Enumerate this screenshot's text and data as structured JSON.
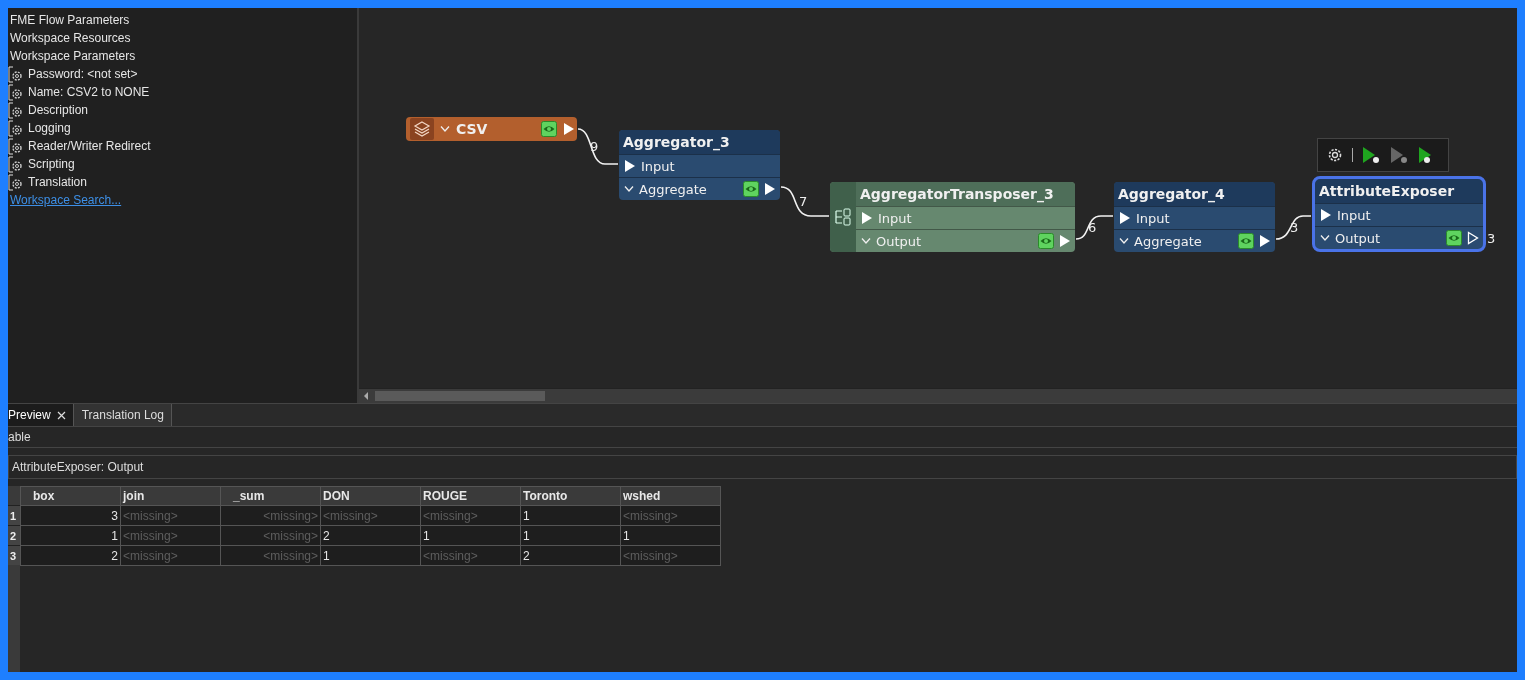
{
  "navigator": {
    "items": [
      {
        "kind": "heading",
        "label": "FME Flow Parameters"
      },
      {
        "kind": "heading",
        "label": "Workspace Resources"
      },
      {
        "kind": "heading",
        "label": "Workspace Parameters"
      },
      {
        "kind": "parameter",
        "label": "Password: <not set>"
      },
      {
        "kind": "parameter",
        "label": "Name: CSV2 to NONE"
      },
      {
        "kind": "parameter",
        "label": "Description"
      },
      {
        "kind": "parameter",
        "label": "Logging"
      },
      {
        "kind": "parameter",
        "label": "Reader/Writer Redirect"
      },
      {
        "kind": "parameter",
        "label": "Scripting"
      },
      {
        "kind": "parameter",
        "label": "Translation"
      },
      {
        "kind": "link",
        "label": "Workspace Search..."
      }
    ]
  },
  "canvas": {
    "nodes": [
      {
        "kind": "reader",
        "name": "CSV",
        "selected": false,
        "outputs": [
          {
            "cached": true,
            "connected": true
          }
        ]
      },
      {
        "kind": "transformer",
        "name": "Aggregator_3",
        "selected": false,
        "inputs": [
          {
            "label": "Input"
          }
        ],
        "outputs": [
          {
            "label": "Aggregate",
            "cached": true,
            "connected": true
          }
        ]
      },
      {
        "kind": "custom",
        "name": "AggregatorTransposer_3",
        "selected": false,
        "inputs": [
          {
            "label": "Input"
          }
        ],
        "outputs": [
          {
            "label": "Output",
            "cached": true,
            "connected": true
          }
        ]
      },
      {
        "kind": "transformer",
        "name": "Aggregator_4",
        "selected": false,
        "inputs": [
          {
            "label": "Input"
          }
        ],
        "outputs": [
          {
            "label": "Aggregate",
            "cached": true,
            "connected": true
          }
        ]
      },
      {
        "kind": "transformer",
        "name": "AttributeExposer",
        "selected": true,
        "inputs": [
          {
            "label": "Input"
          }
        ],
        "outputs": [
          {
            "label": "Output",
            "cached": true,
            "connected": false,
            "count": "3"
          }
        ]
      }
    ],
    "connections": [
      {
        "count": "9"
      },
      {
        "count": "7"
      },
      {
        "count": "6"
      },
      {
        "count": "3"
      }
    ]
  },
  "bottom_tabs": [
    {
      "label": "Preview",
      "selected": true,
      "closable": true
    },
    {
      "label": "Translation Log",
      "selected": false,
      "closable": false
    }
  ],
  "view_label": "able",
  "table": {
    "title": "AttributeExposer: Output",
    "columns": [
      {
        "label": "box",
        "numeric": true
      },
      {
        "label": "join",
        "numeric": false
      },
      {
        "label": "_sum",
        "numeric": true
      },
      {
        "label": "DON",
        "numeric": false
      },
      {
        "label": "ROUGE",
        "numeric": false
      },
      {
        "label": "Toronto",
        "numeric": false
      },
      {
        "label": "wshed",
        "numeric": false
      }
    ],
    "rows": [
      {
        "number": "1",
        "cells": [
          {
            "text": "3",
            "missing": false
          },
          {
            "text": "<missing>",
            "missing": true
          },
          {
            "text": "<missing>",
            "missing": true
          },
          {
            "text": "<missing>",
            "missing": true
          },
          {
            "text": "<missing>",
            "missing": true
          },
          {
            "text": "1",
            "missing": false
          },
          {
            "text": "<missing>",
            "missing": true
          }
        ]
      },
      {
        "number": "2",
        "cells": [
          {
            "text": "1",
            "missing": false
          },
          {
            "text": "<missing>",
            "missing": true
          },
          {
            "text": "<missing>",
            "missing": true
          },
          {
            "text": "2",
            "missing": false
          },
          {
            "text": "1",
            "missing": false
          },
          {
            "text": "1",
            "missing": false
          },
          {
            "text": "1",
            "missing": false
          }
        ]
      },
      {
        "number": "3",
        "cells": [
          {
            "text": "2",
            "missing": false
          },
          {
            "text": "<missing>",
            "missing": true
          },
          {
            "text": "<missing>",
            "missing": true
          },
          {
            "text": "1",
            "missing": false
          },
          {
            "text": "<missing>",
            "missing": true
          },
          {
            "text": "2",
            "missing": false
          },
          {
            "text": "<missing>",
            "missing": true
          }
        ]
      }
    ]
  }
}
